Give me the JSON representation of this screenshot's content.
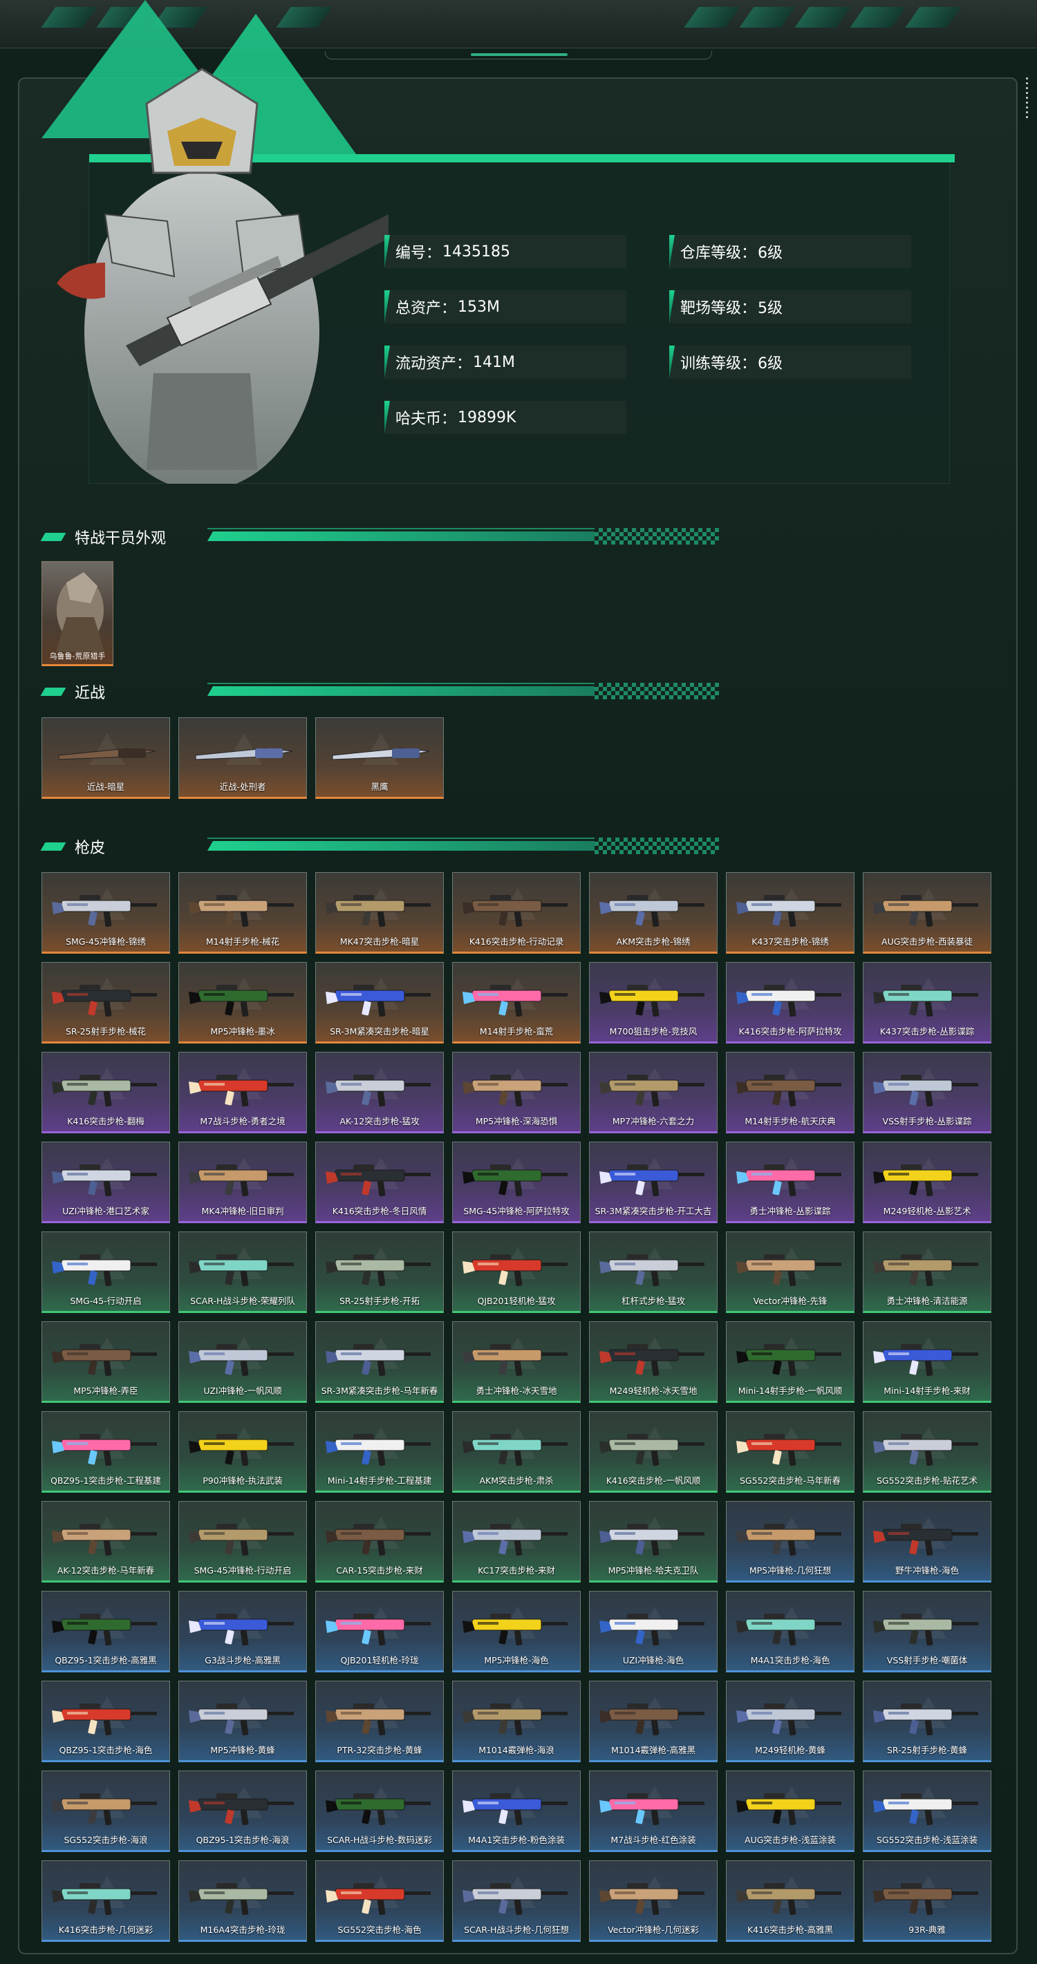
{
  "profile": {
    "id_label": "编号：",
    "id_value": "1435185",
    "total_assets_label": "总资产：",
    "total_assets_value": "153M",
    "liquid_assets_label": "流动资产：",
    "liquid_assets_value": "141M",
    "hafu_label": "哈夫币：",
    "hafu_value": "19899K",
    "warehouse_label": "仓库等级：",
    "warehouse_value": "6级",
    "range_label": "靶场等级：",
    "range_value": "5级",
    "training_label": "训练等级：",
    "training_value": "6级"
  },
  "sections": {
    "operators_title": "特战干员外观",
    "melee_title": "近战",
    "skins_title": "枪皮"
  },
  "operators": [
    {
      "name": "乌鲁鲁-荒原猎手"
    }
  ],
  "melee": [
    {
      "name": "近战-暗星",
      "rarity": "orange"
    },
    {
      "name": "近战-处刑者",
      "rarity": "orange"
    },
    {
      "name": "黑鹰",
      "rarity": "orange"
    }
  ],
  "colors": {
    "accent": "#1fd08e",
    "orange": "#e4873a",
    "purple": "#9b63d8",
    "green": "#40c777",
    "blue": "#4f93d8"
  },
  "skins": [
    {
      "name": "SMG-45冲锋枪-锦绣",
      "rarity": "orange"
    },
    {
      "name": "M14射手步枪-械花",
      "rarity": "orange"
    },
    {
      "name": "MK47突击步枪-暗星",
      "rarity": "orange"
    },
    {
      "name": "K416突击步枪-行动记录",
      "rarity": "orange"
    },
    {
      "name": "AKM突击步枪-锦绣",
      "rarity": "orange"
    },
    {
      "name": "K437突击步枪-锦绣",
      "rarity": "orange"
    },
    {
      "name": "AUG突击步枪-西装暴徒",
      "rarity": "orange"
    },
    {
      "name": "SR-25射手步枪-械花",
      "rarity": "orange"
    },
    {
      "name": "MP5冲锋枪-墨冰",
      "rarity": "orange"
    },
    {
      "name": "SR-3M紧凑突击步枪-暗星",
      "rarity": "orange"
    },
    {
      "name": "M14射手步枪-蛮荒",
      "rarity": "orange"
    },
    {
      "name": "M700狙击步枪-竞技风",
      "rarity": "purple"
    },
    {
      "name": "K416突击步枪-阿萨拉特攻",
      "rarity": "purple"
    },
    {
      "name": "K437突击步枪-丛影谍踪",
      "rarity": "purple"
    },
    {
      "name": "K416突击步枪-翻梅",
      "rarity": "purple"
    },
    {
      "name": "M7战斗步枪-勇者之境",
      "rarity": "purple"
    },
    {
      "name": "AK-12突击步枪-猛攻",
      "rarity": "purple"
    },
    {
      "name": "MP5冲锋枪-深海恐惧",
      "rarity": "purple"
    },
    {
      "name": "MP7冲锋枪-六套之力",
      "rarity": "purple"
    },
    {
      "name": "M14射手步枪-航天庆典",
      "rarity": "purple"
    },
    {
      "name": "VSS射手步枪-丛影谍踪",
      "rarity": "purple"
    },
    {
      "name": "UZI冲锋枪-港口艺术家",
      "rarity": "purple"
    },
    {
      "name": "MK4冲锋枪-旧日审判",
      "rarity": "purple"
    },
    {
      "name": "K416突击步枪-冬日风情",
      "rarity": "purple"
    },
    {
      "name": "SMG-45冲锋枪-阿萨拉特攻",
      "rarity": "purple"
    },
    {
      "name": "SR-3M紧凑突击步枪-开工大吉",
      "rarity": "purple"
    },
    {
      "name": "勇士冲锋枪-丛影谍踪",
      "rarity": "purple"
    },
    {
      "name": "M249轻机枪-丛影艺术",
      "rarity": "purple"
    },
    {
      "name": "SMG-45-行动开启",
      "rarity": "green"
    },
    {
      "name": "SCAR-H战斗步枪-荣耀列队",
      "rarity": "green"
    },
    {
      "name": "SR-25射手步枪-开拓",
      "rarity": "green"
    },
    {
      "name": "QJB201轻机枪-猛攻",
      "rarity": "green"
    },
    {
      "name": "杠杆式步枪-猛攻",
      "rarity": "green"
    },
    {
      "name": "Vector冲锋枪-先锋",
      "rarity": "green"
    },
    {
      "name": "勇士冲锋枪-清洁能源",
      "rarity": "green"
    },
    {
      "name": "MP5冲锋枪-弄臣",
      "rarity": "green"
    },
    {
      "name": "UZI冲锋枪-一帆风顺",
      "rarity": "green"
    },
    {
      "name": "SR-3M紧凑突击步枪-马年新春",
      "rarity": "green"
    },
    {
      "name": "勇士冲锋枪-冰天雪地",
      "rarity": "green"
    },
    {
      "name": "M249轻机枪-冰天雪地",
      "rarity": "green"
    },
    {
      "name": "Mini-14射手步枪-一帆风顺",
      "rarity": "green"
    },
    {
      "name": "Mini-14射手步枪-来财",
      "rarity": "green"
    },
    {
      "name": "QBZ95-1突击步枪-工程基建",
      "rarity": "green"
    },
    {
      "name": "P90冲锋枪-执法武装",
      "rarity": "green"
    },
    {
      "name": "Mini-14射手步枪-工程基建",
      "rarity": "green"
    },
    {
      "name": "AKM突击步枪-肃杀",
      "rarity": "green"
    },
    {
      "name": "K416突击步枪-一帆风顺",
      "rarity": "green"
    },
    {
      "name": "SG552突击步枪-马年新春",
      "rarity": "green"
    },
    {
      "name": "SG552突击步枪-贴花艺术",
      "rarity": "green"
    },
    {
      "name": "AK-12突击步枪-马年新春",
      "rarity": "green"
    },
    {
      "name": "SMG-45冲锋枪-行动开启",
      "rarity": "green"
    },
    {
      "name": "CAR-15突击步枪-来财",
      "rarity": "green"
    },
    {
      "name": "KC17突击步枪-来财",
      "rarity": "green"
    },
    {
      "name": "MP5冲锋枪-哈夫克卫队",
      "rarity": "green"
    },
    {
      "name": "MP5冲锋枪-几何狂想",
      "rarity": "blue"
    },
    {
      "name": "野牛冲锋枪-海色",
      "rarity": "blue"
    },
    {
      "name": "QBZ95-1突击步枪-高雅黑",
      "rarity": "blue"
    },
    {
      "name": "G3战斗步枪-高雅黑",
      "rarity": "blue"
    },
    {
      "name": "QJB201轻机枪-玲珑",
      "rarity": "blue"
    },
    {
      "name": "MP5冲锋枪-海色",
      "rarity": "blue"
    },
    {
      "name": "UZI冲锋枪-海色",
      "rarity": "blue"
    },
    {
      "name": "M4A1突击步枪-海色",
      "rarity": "blue"
    },
    {
      "name": "VSS射手步枪-嘲菌体",
      "rarity": "blue"
    },
    {
      "name": "QBZ95-1突击步枪-海色",
      "rarity": "blue"
    },
    {
      "name": "MP5冲锋枪-黄蜂",
      "rarity": "blue"
    },
    {
      "name": "PTR-32突击步枪-黄蜂",
      "rarity": "blue"
    },
    {
      "name": "M1014霰弹枪-海浪",
      "rarity": "blue"
    },
    {
      "name": "M1014霰弹枪-高雅黑",
      "rarity": "blue"
    },
    {
      "name": "M249轻机枪-黄蜂",
      "rarity": "blue"
    },
    {
      "name": "SR-25射手步枪-黄蜂",
      "rarity": "blue"
    },
    {
      "name": "SG552突击步枪-海浪",
      "rarity": "blue"
    },
    {
      "name": "QBZ95-1突击步枪-海浪",
      "rarity": "blue"
    },
    {
      "name": "SCAR-H战斗步枪-数码迷彩",
      "rarity": "blue"
    },
    {
      "name": "M4A1突击步枪-粉色涂装",
      "rarity": "blue"
    },
    {
      "name": "M7战斗步枪-红色涂装",
      "rarity": "blue"
    },
    {
      "name": "AUG突击步枪-浅蓝涂装",
      "rarity": "blue"
    },
    {
      "name": "SG552突击步枪-浅蓝涂装",
      "rarity": "blue"
    },
    {
      "name": "K416突击步枪-几何迷彩",
      "rarity": "blue"
    },
    {
      "name": "M16A4突击步枪-玲珑",
      "rarity": "blue"
    },
    {
      "name": "SG552突击步枪-海色",
      "rarity": "blue"
    },
    {
      "name": "SCAR-H战斗步枪-几何狂想",
      "rarity": "blue"
    },
    {
      "name": "Vector冲锋枪-几何迷彩",
      "rarity": "blue"
    },
    {
      "name": "K416突击步枪-高雅黑",
      "rarity": "blue"
    },
    {
      "name": "93R-典雅",
      "rarity": "blue"
    }
  ]
}
